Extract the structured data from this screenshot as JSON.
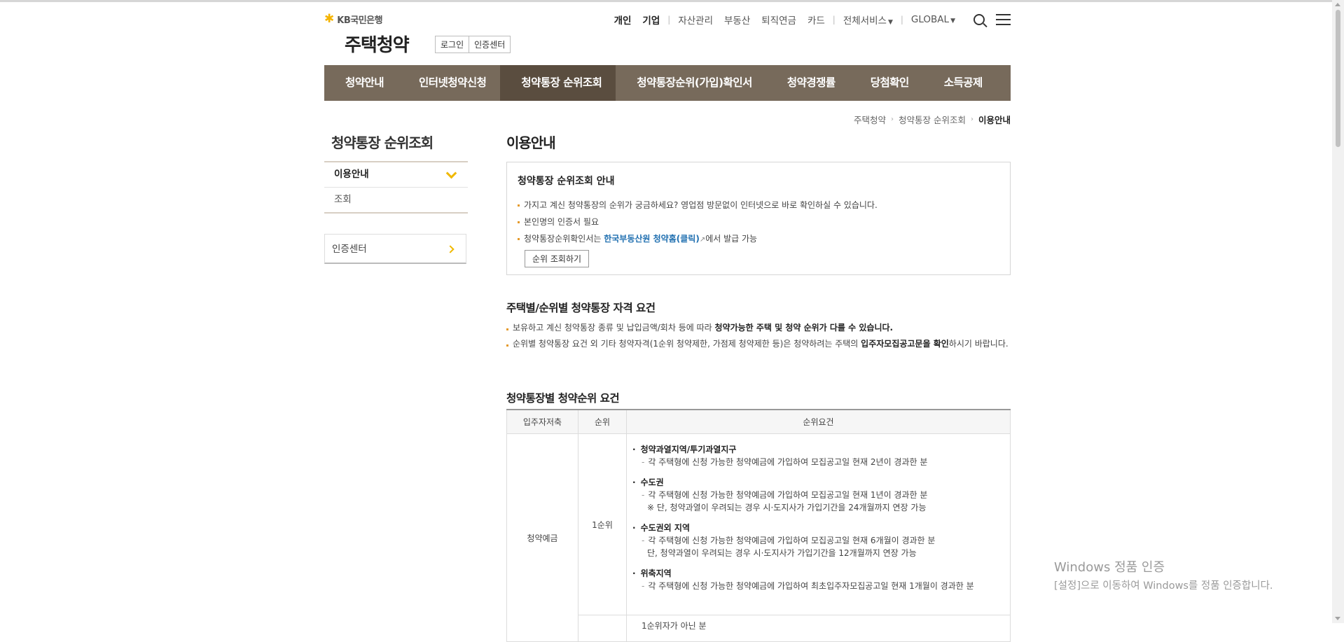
{
  "header": {
    "logo_text": "KB국민은행",
    "site_title": "주택청약",
    "login_label": "로그인",
    "cert_center_label": "인증센터",
    "util": {
      "personal": "개인",
      "business": "기업",
      "asset": "자산관리",
      "realestate": "부동산",
      "pension": "퇴직연금",
      "card": "카드",
      "all_services": "전체서비스",
      "global": "GLOBAL"
    }
  },
  "gnb": {
    "items": [
      "청약안내",
      "인터넷청약신청",
      "청약통장 순위조회",
      "청약통장순위(가입)확인서",
      "청약경쟁률",
      "당첨확인",
      "소득공제"
    ],
    "active_index": 2
  },
  "breadcrumb": [
    "주택청약",
    "청약통장 순위조회",
    "이용안내"
  ],
  "lnb": {
    "title": "청약통장 순위조회",
    "items": [
      "이용안내",
      "조회"
    ],
    "cert_box": "인증센터"
  },
  "content": {
    "page_title": "이용안내",
    "guide": {
      "title": "청약통장 순위조회 안내",
      "bullet1": "가지고 계신 청약통장의 순위가 궁금하세요? 영업점 방문없이 인터넷으로 바로 확인하실 수 있습니다.",
      "bullet2": "본인명의 인증서 필요",
      "bullet3_pre": "청약통장순위확인서는 ",
      "bullet3_link": "한국부동산원 청약홈(클릭)",
      "bullet3_post": "에서 발급 가능",
      "button": "순위 조회하기"
    },
    "sec1": {
      "title": "주택별/순위별 청약통장 자격 요건",
      "b1_pre": "보유하고 계신 청약통장 종류 및 납입금액/회차 등에 따라 ",
      "b1_bold": "청약가능한 주택 및 청약 순위가 다를 수 있습니다.",
      "b2_pre": "순위별 청약통장 요건 외 기타 청약자격(1순위 청약제한, 가점제 청약제한 등)은 청약하려는 주택의 ",
      "b2_bold": "입주자모집공고문을 확인",
      "b2_post": "하시기 바랍니다."
    },
    "sec2": {
      "title": "청약통장별 청약순위 요건",
      "headers": [
        "입주자저축",
        "순위",
        "순위요건"
      ],
      "row_type": "청약예금",
      "row_rank": "1순위",
      "reqs": [
        {
          "h": "청약과열지역/투기과열지구",
          "d": "각 주택형에 신청 가능한 청약예금에 가입하여 모집공고일 현재 2년이 경과한 분"
        },
        {
          "h": "수도권",
          "d": "각 주택형에 신청 가능한 청약예금에 가입하여 모집공고일 현재 1년이 경과한 분",
          "note": "※ 단, 청약과열이 우려되는 경우 시·도지사가 가입기간을 24개월까지 연장 가능"
        },
        {
          "h": "수도권외 지역",
          "d": "각 주택형에 신청 가능한 청약예금에 가입하여 모집공고일 현재 6개월이 경과한 분",
          "note": "단, 청약과열이 우려되는 경우 시·도지사가 가입기간을 12개월까지 연장 가능"
        },
        {
          "h": "위축지역",
          "d": "각 주택형에 신청 가능한 청약예금에 가입하여 최초입주자모집공고일 현재 1개월이 경과한 분"
        }
      ],
      "next_row_partial": "1순위자가 아닌 분"
    }
  },
  "watermark": {
    "line1": "Windows 정품 인증",
    "line2": "[설정]으로 이동하여 Windows를 정품 인증합니다."
  }
}
